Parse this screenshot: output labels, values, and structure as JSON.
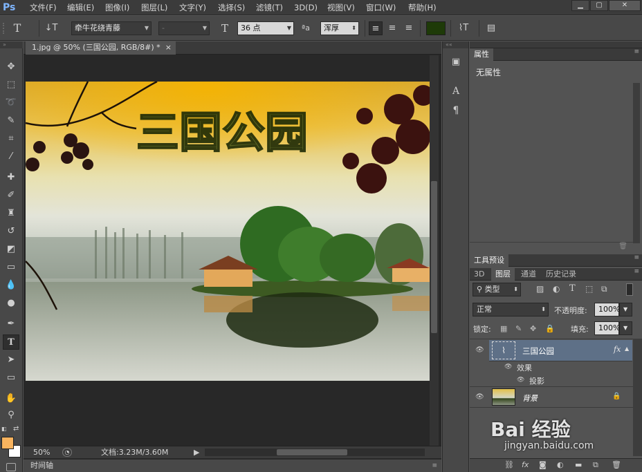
{
  "app": {
    "logo": "Ps"
  },
  "menu": [
    "文件(F)",
    "编辑(E)",
    "图像(I)",
    "图层(L)",
    "文字(Y)",
    "选择(S)",
    "滤镜(T)",
    "3D(D)",
    "视图(V)",
    "窗口(W)",
    "帮助(H)"
  ],
  "window_controls": {
    "minimize": "▁",
    "maximize": "▢",
    "close": "✕"
  },
  "options": {
    "font_family": "牵牛花绕青藤",
    "font_style": "-",
    "font_size": "36 点",
    "aa_icon_label": "ªa",
    "antialias": "浑厚",
    "text_color": "#1e3a08"
  },
  "document": {
    "tab_title": "1.jpg @ 50% (三国公园, RGB/8#) *",
    "tab_close": "×",
    "zoom": "50%",
    "doc_info": "文档:3.23M/3.60M",
    "artwork_text": "三国公园"
  },
  "timeline_label": "时间轴",
  "properties": {
    "tab": "属性",
    "content": "无属性"
  },
  "tool_presets_tab": "工具预设",
  "layers_panel": {
    "tabs": [
      "3D",
      "图层",
      "通道",
      "历史记录"
    ],
    "active_tab": "图层",
    "filter_type": "类型",
    "blend_mode": "正常",
    "opacity_label": "不透明度:",
    "opacity_value": "100%",
    "lock_label": "锁定:",
    "fill_label": "填充:",
    "fill_value": "100%",
    "layers": [
      {
        "name": "三国公园",
        "fx": "fx",
        "effects_label": "效果",
        "effect": "投影"
      },
      {
        "name": "背景"
      }
    ]
  },
  "watermark": {
    "main": "Bai 经验",
    "sub": "jingyan.baidu.com"
  },
  "colors": {
    "accent": "#7fb6ff",
    "foreground": "#f8b35e",
    "background": "#ffffff",
    "selected_layer": "#5e7087"
  }
}
